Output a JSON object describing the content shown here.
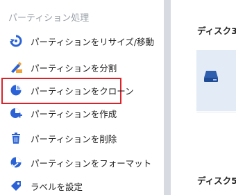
{
  "sidebar": {
    "section_title": "パーティション処理",
    "items": [
      {
        "label": "パーティションをリサイズ/移動",
        "icon": "resize-move-icon"
      },
      {
        "label": "パーティションを分割",
        "icon": "split-partition-icon"
      },
      {
        "label": "パーティションをクローン",
        "icon": "clone-partition-icon"
      },
      {
        "label": "パーティションを作成",
        "icon": "create-partition-icon"
      },
      {
        "label": "パーティションを削除",
        "icon": "delete-trash-icon"
      },
      {
        "label": "パーティションをフォーマット",
        "icon": "format-partition-icon"
      },
      {
        "label": "ラベルを設定",
        "icon": "label-tag-icon"
      }
    ],
    "highlighted_item": "パーティションをクローン"
  },
  "main": {
    "disks": [
      {
        "label": "ディスク3",
        "icon": "hard-drive-icon"
      },
      {
        "label": "ディスク5"
      }
    ]
  },
  "colors": {
    "icon_blue": "#2b63d6",
    "highlight_red": "#d9232b",
    "accent_orange": "#f2a23a",
    "section_gray": "#9aa0a8"
  }
}
